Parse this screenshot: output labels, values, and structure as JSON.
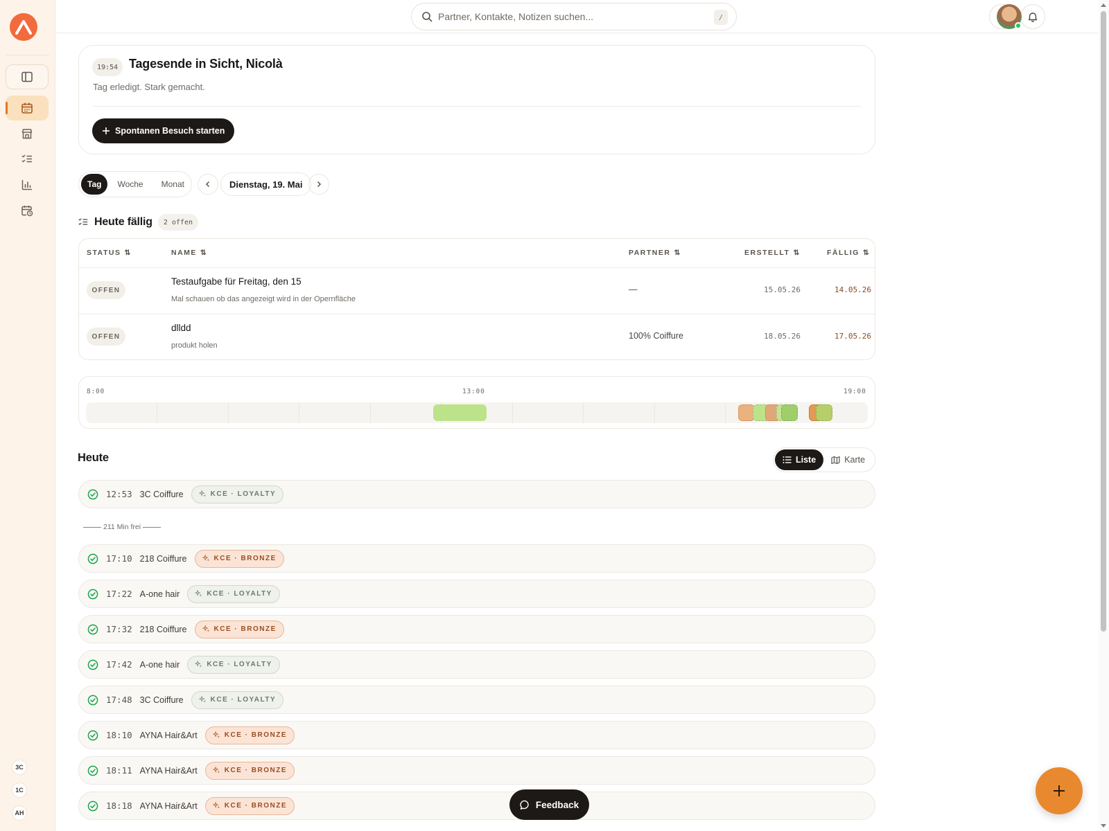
{
  "topbar": {
    "search_placeholder": "Partner, Kontakte, Notizen suchen...",
    "search_shortcut": "/"
  },
  "sidebar": {
    "items": [
      {
        "icon": "sidebar-toggle-icon"
      },
      {
        "icon": "calendar-icon",
        "active": true
      },
      {
        "icon": "store-icon"
      },
      {
        "icon": "task-list-icon"
      },
      {
        "icon": "bar-chart-icon"
      },
      {
        "icon": "calendar-clock-icon"
      }
    ],
    "accounts": [
      "3C",
      "1C",
      "AH"
    ]
  },
  "hero": {
    "time": "19:54",
    "title": "Tagesende in Sicht, Nicolà",
    "subtitle": "Tag erledigt. Stark gemacht.",
    "button_label": "Spontanen Besuch starten"
  },
  "date_nav": {
    "views": [
      "Tag",
      "Woche",
      "Monat"
    ],
    "active_view": "Tag",
    "date_label": "Dienstag, 19. Mai"
  },
  "due": {
    "title": "Heute fällig",
    "count_label": "2 offen",
    "columns": [
      "STATUS",
      "NAME",
      "PARTNER",
      "ERSTELLT",
      "FÄLLIG"
    ],
    "rows": [
      {
        "status": "OFFEN",
        "title": "Testaufgabe für Freitag, den 15",
        "description": "Mal schauen ob das angezeigt wird in der Opernfläche",
        "partner": "—",
        "created": "15.05.26",
        "due": "14.05.26"
      },
      {
        "status": "OFFEN",
        "title": "dlldd",
        "description": "produkt holen",
        "partner": "100% Coiffure",
        "created": "18.05.26",
        "due": "17.05.26"
      }
    ]
  },
  "timeline": {
    "start_label": "8:00",
    "mid_label": "13:00",
    "end_label": "19:00"
  },
  "today": {
    "title": "Heute",
    "view_list": "Liste",
    "view_map": "Karte",
    "gap_note": "211 Min frei",
    "colors": {
      "loyalty": "#eef1ec",
      "bronze": "#fbe4d6",
      "done": "#16a34a"
    },
    "visits": [
      {
        "time": "12:53",
        "name": "3C Coiffure",
        "tag": "KCE · LOYALTY",
        "tier": "loyalty"
      },
      {
        "time": "17:10",
        "name": "218 Coiffure",
        "tag": "KCE · BRONZE",
        "tier": "bronze"
      },
      {
        "time": "17:22",
        "name": "A-one hair",
        "tag": "KCE · LOYALTY",
        "tier": "loyalty"
      },
      {
        "time": "17:32",
        "name": "218 Coiffure",
        "tag": "KCE · BRONZE",
        "tier": "bronze"
      },
      {
        "time": "17:42",
        "name": "A-one hair",
        "tag": "KCE · LOYALTY",
        "tier": "loyalty"
      },
      {
        "time": "17:48",
        "name": "3C Coiffure",
        "tag": "KCE · LOYALTY",
        "tier": "loyalty"
      },
      {
        "time": "18:10",
        "name": "AYNA Hair&Art",
        "tag": "KCE · BRONZE",
        "tier": "bronze"
      },
      {
        "time": "18:11",
        "name": "AYNA Hair&Art",
        "tag": "KCE · BRONZE",
        "tier": "bronze"
      },
      {
        "time": "18:18",
        "name": "AYNA Hair&Art",
        "tag": "KCE · BRONZE",
        "tier": "bronze"
      }
    ]
  },
  "feedback_label": "Feedback"
}
